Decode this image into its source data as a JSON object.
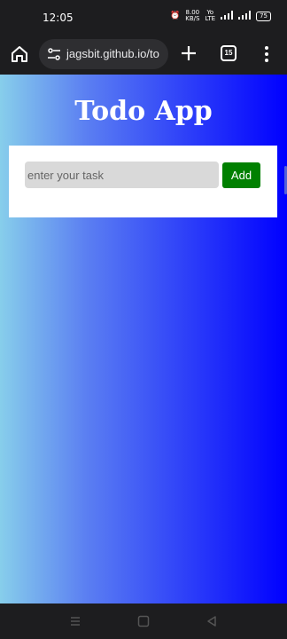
{
  "status_bar": {
    "time": "12:05",
    "net_speed_top": "8.00",
    "net_speed_bottom": "KB/S",
    "volte_top": "Yo",
    "volte_bottom": "LTE",
    "battery": "75"
  },
  "browser": {
    "url": "jagsbit.github.io/to",
    "tab_count": "15"
  },
  "app": {
    "title": "Todo App",
    "input_placeholder": "enter your task",
    "add_label": "Add"
  },
  "colors": {
    "gradient_start": "#87ceeb",
    "gradient_end": "#0000ff",
    "add_button": "#008000"
  }
}
